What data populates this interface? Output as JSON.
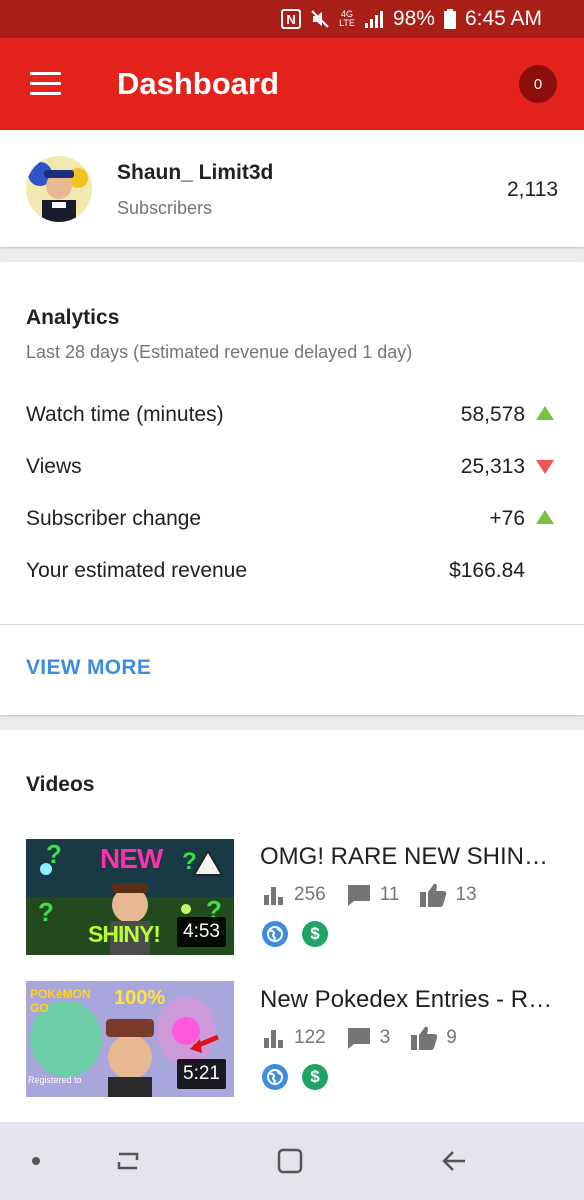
{
  "status_bar": {
    "battery": "98%",
    "time": "6:45 AM",
    "nfc": "N",
    "network": "4G\nLTE"
  },
  "app_bar": {
    "title": "Dashboard",
    "notifications": "0"
  },
  "channel": {
    "name": "Shaun_ Limit3d",
    "subscribers_label": "Subscribers",
    "subscriber_count": "2,113"
  },
  "analytics": {
    "title": "Analytics",
    "range": "Last 28 days (Estimated revenue delayed 1 day)",
    "metrics": [
      {
        "label": "Watch time (minutes)",
        "value": "58,578",
        "trend": "up"
      },
      {
        "label": "Views",
        "value": "25,313",
        "trend": "down"
      },
      {
        "label": "Subscriber change",
        "value": "+76",
        "trend": "up"
      },
      {
        "label": "Your estimated revenue",
        "value": "$166.84",
        "trend": "none"
      }
    ],
    "view_more": "VIEW MORE"
  },
  "videos": {
    "title": "Videos",
    "items": [
      {
        "title": "OMG! RARE NEW SHINY POKEMON",
        "duration": "4:53",
        "views": "256",
        "comments": "11",
        "likes": "13",
        "thumb_text_1": "NEW",
        "thumb_text_2": "SHINY!"
      },
      {
        "title": "New Pokedex Entries - Registered",
        "duration": "5:21",
        "views": "122",
        "comments": "3",
        "likes": "9",
        "thumb_text_1": "100%",
        "thumb_text_2": "POKéMON GO"
      }
    ]
  },
  "colors": {
    "status_bar": "#a81f18",
    "app_bar": "#e3221b",
    "accent_blue": "#3e8ce0",
    "trend_up": "#7ac142",
    "trend_down": "#f05454",
    "money_green": "#1fa463"
  }
}
